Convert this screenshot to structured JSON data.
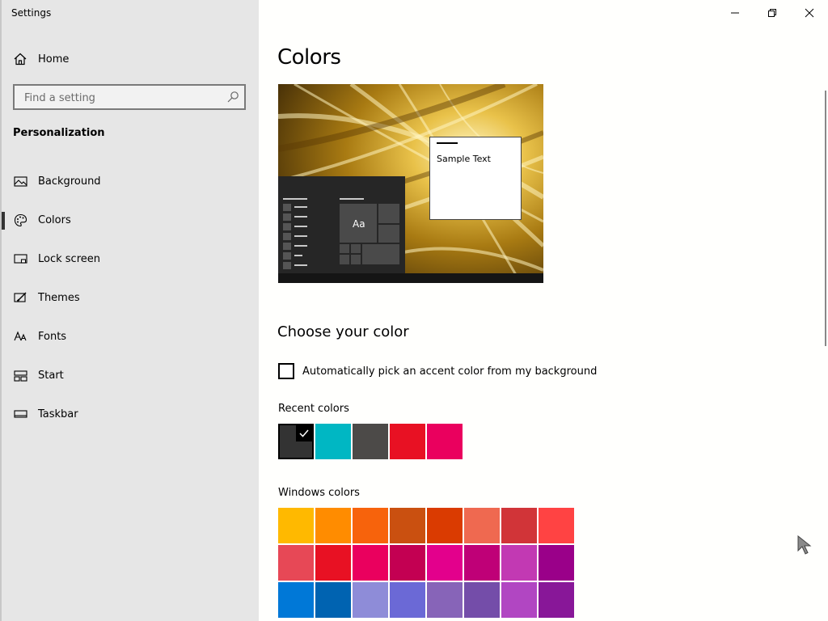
{
  "app": {
    "title": "Settings"
  },
  "sidebar": {
    "home_label": "Home",
    "search_placeholder": "Find a setting",
    "section_title": "Personalization",
    "items": [
      {
        "label": "Background",
        "icon": "image-icon"
      },
      {
        "label": "Colors",
        "icon": "palette-icon",
        "selected": true
      },
      {
        "label": "Lock screen",
        "icon": "lock-screen-icon"
      },
      {
        "label": "Themes",
        "icon": "themes-brush-icon"
      },
      {
        "label": "Fonts",
        "icon": "fonts-icon"
      },
      {
        "label": "Start",
        "icon": "start-icon"
      },
      {
        "label": "Taskbar",
        "icon": "taskbar-icon"
      }
    ]
  },
  "main": {
    "title": "Colors",
    "preview": {
      "sample_text": "Sample Text",
      "tile_text": "Aa"
    },
    "choose_heading": "Choose your color",
    "auto_pick_label": "Automatically pick an accent color from my background",
    "auto_pick_checked": false,
    "recent_label": "Recent colors",
    "recent_colors": [
      "#333333",
      "#00b7c3",
      "#4c4a48",
      "#e81123",
      "#ea005e"
    ],
    "recent_selected_index": 0,
    "windows_label": "Windows colors",
    "windows_colors": [
      "#ffb900",
      "#ff8c00",
      "#f7630c",
      "#ca5010",
      "#da3b01",
      "#ef6950",
      "#d13438",
      "#ff4343",
      "#e74856",
      "#e81123",
      "#ea005e",
      "#c30052",
      "#e3008c",
      "#bf0077",
      "#c239b3",
      "#9a0089",
      "#0078d7",
      "#0063b1",
      "#8e8cd8",
      "#6b69d6",
      "#8764b8",
      "#744da9",
      "#b146c2",
      "#881798"
    ]
  },
  "window_controls": {
    "minimize": "minimize-icon",
    "restore": "restore-icon",
    "close": "close-icon"
  }
}
